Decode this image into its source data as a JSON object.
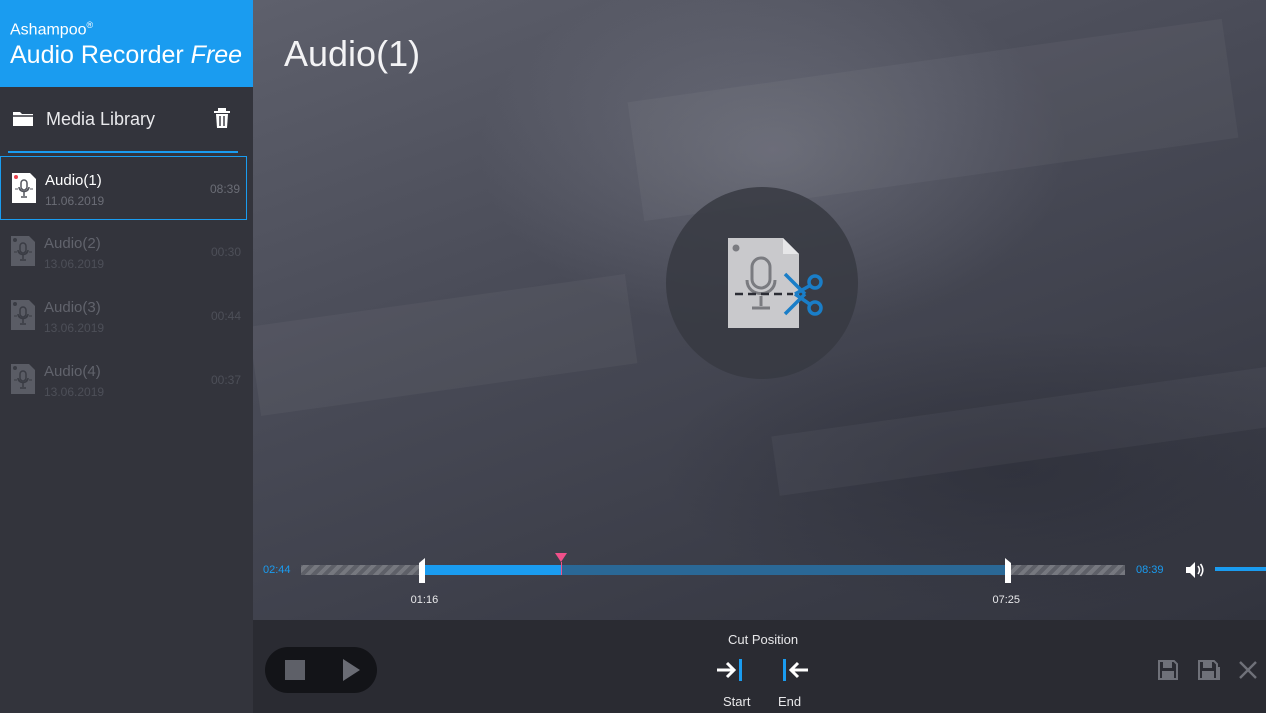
{
  "brand": {
    "company": "Ashampoo",
    "registered": "®",
    "product": "Audio Recorder",
    "edition": "Free"
  },
  "sidebar": {
    "library_label": "Media Library",
    "items": [
      {
        "title": "Audio(1)",
        "date": "11.06.2019",
        "duration": "08:39",
        "active": true
      },
      {
        "title": "Audio(2)",
        "date": "13.06.2019",
        "duration": "00:30",
        "active": false
      },
      {
        "title": "Audio(3)",
        "date": "13.06.2019",
        "duration": "00:44",
        "active": false
      },
      {
        "title": "Audio(4)",
        "date": "13.06.2019",
        "duration": "00:37",
        "active": false
      }
    ]
  },
  "main": {
    "title": "Audio(1)",
    "window_controls": [
      "feedback-icon",
      "skin-icon",
      "help-icon",
      "minimize-icon",
      "maximize-icon",
      "close-icon"
    ]
  },
  "timeline": {
    "current": "02:44",
    "total": "08:39",
    "cut_start": "01:16",
    "cut_end": "07:25",
    "total_seconds": 519,
    "current_seconds": 164,
    "cut_start_seconds": 76,
    "cut_end_seconds": 445,
    "volume_percent": 100
  },
  "controls": {
    "cut_position_label": "Cut Position",
    "start_label": "Start",
    "end_label": "End"
  },
  "colors": {
    "accent": "#1a9cf0",
    "playhead": "#f0508a"
  }
}
